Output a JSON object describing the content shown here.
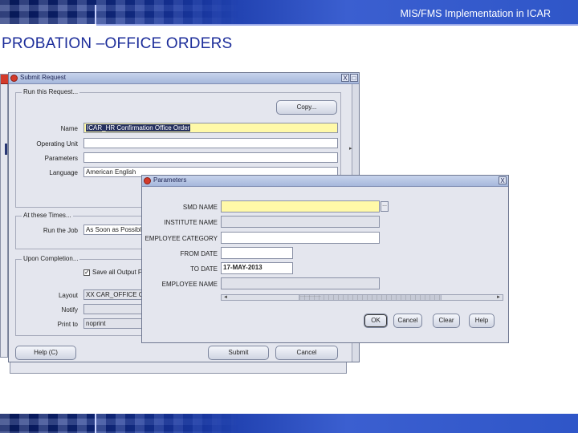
{
  "slide": {
    "header_title": "MIS/FMS Implementation in ICAR",
    "title": "PROBATION –OFFICE ORDERS"
  },
  "submit_request_window": {
    "title": "Submit Request",
    "run_this_request_label": "Run this Request...",
    "copy_button": "Copy...",
    "fields": {
      "name_label": "Name",
      "name_value": "ICAR_HR Confirmation Office Order",
      "operating_unit_label": "Operating Unit",
      "operating_unit_value": "",
      "parameters_label": "Parameters",
      "parameters_value": "",
      "language_label": "Language",
      "language_value": "American English"
    },
    "at_these_times_label": "At these Times...",
    "run_the_job_label": "Run the Job",
    "run_the_job_value": "As Soon as Possible",
    "upon_completion_label": "Upon Completion...",
    "save_all_output_label": "Save all Output Files",
    "save_all_output_checked": true,
    "layout_label": "Layout",
    "layout_value": "XX CAR_OFFICE O",
    "notify_label": "Notify",
    "notify_value": "",
    "print_to_label": "Print to",
    "print_to_value": "noprint",
    "help_button": "Help (C)",
    "submit_button": "Submit",
    "cancel_button": "Cancel"
  },
  "parameters_window": {
    "title": "Parameters",
    "fields": [
      {
        "label": "SMD NAME",
        "value": "",
        "style": "yellow"
      },
      {
        "label": "INSTITUTE NAME",
        "value": "",
        "style": "gray"
      },
      {
        "label": "EMPLOYEE CATEGORY",
        "value": "",
        "style": "white"
      },
      {
        "label": "FROM DATE",
        "value": "",
        "style": "white"
      },
      {
        "label": "TO DATE",
        "value": "17-MAY-2013",
        "style": "white"
      },
      {
        "label": "EMPLOYEE NAME",
        "value": "",
        "style": "gray"
      }
    ],
    "lov_button": "...",
    "scrollbar_text": "·············",
    "ok_button": "OK",
    "cancel_button": "Cancel",
    "clear_button": "Clear",
    "help_button": "Help"
  },
  "icons": {
    "window_close": "X",
    "window_maximize": "□",
    "checkbox_mark": "✓",
    "scroll_left": "◄",
    "scroll_right": "►"
  },
  "colors": {
    "banner_blue": "#1a3aa8",
    "title_blue": "#1c2d9a",
    "required_field": "#fff9a8",
    "window_bg": "#e4e6ee"
  }
}
